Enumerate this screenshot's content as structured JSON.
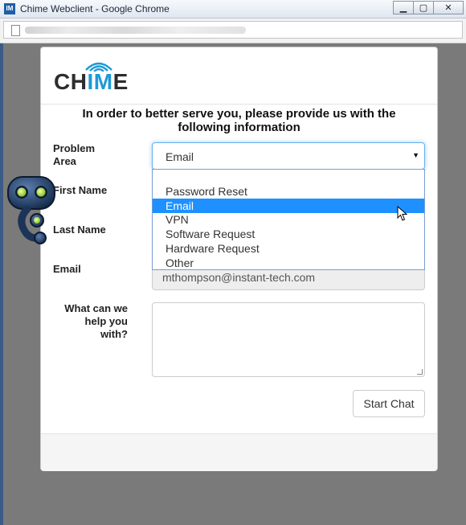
{
  "window": {
    "title": "Chime Webclient - Google Chrome",
    "app_icon": "IM",
    "controls": [
      "minimize",
      "maximize",
      "close"
    ]
  },
  "browser": {
    "url_obscured": true
  },
  "brand": {
    "logo_text_dark": "CH",
    "logo_text_blue": "IM",
    "logo_text_dark2": "E",
    "accent": "#1e9ad6"
  },
  "form": {
    "intro": "In order to better serve you, please provide us with the following information",
    "problem_area": {
      "label_line1": "Problem",
      "label_line2": "Area",
      "value": "Email",
      "options": [
        "",
        "Password Reset",
        "Email",
        "VPN",
        "Software Request",
        "Hardware Request",
        "Other"
      ],
      "highlighted": "Email"
    },
    "first_name": {
      "label": "First Name"
    },
    "last_name": {
      "label": "Last Name"
    },
    "email": {
      "label": "Email",
      "value": "mthompson@instant-tech.com"
    },
    "help": {
      "label_line1": "What can we",
      "label_line2": "help you",
      "label_line3": "with?",
      "value": ""
    },
    "submit_label": "Start Chat"
  },
  "colors": {
    "focus_border": "#66afe9",
    "selected_option": "#1e90ff",
    "background_overlay": "#7a7a7a"
  }
}
